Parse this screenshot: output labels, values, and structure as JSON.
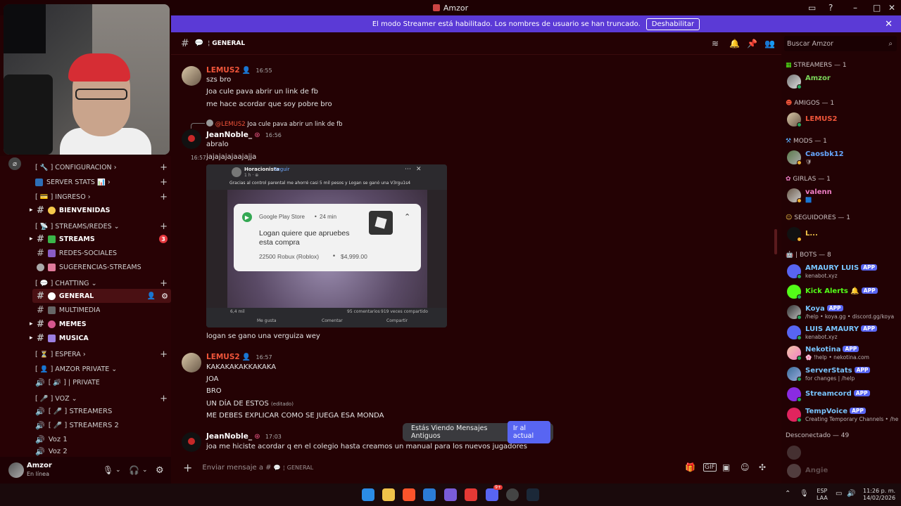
{
  "window": {
    "title": "Amzor"
  },
  "banner": {
    "text": "El modo Streamer está habilitado. Los nombres de usuario se han truncado.",
    "button": "Deshabilitar"
  },
  "channels": [
    {
      "label": "[ 🔧 ] CONFIGURACION",
      "kind": "category",
      "chevron": "›"
    },
    {
      "label": "SERVER STATS 📊",
      "kind": "category",
      "chevron": "›"
    },
    {
      "label": "[ 💳 ] INGRESO",
      "kind": "category",
      "chevron": "›"
    },
    {
      "label": "BIENVENIDAS",
      "kind": "channel",
      "bold": true
    },
    {
      "label": "[ 📡 ] STREAMS/REDES",
      "kind": "category",
      "chevron": "⌄"
    },
    {
      "label": "STREAMS",
      "kind": "channel",
      "bold": true,
      "badge": "3"
    },
    {
      "label": "REDES-SOCIALES",
      "kind": "channel"
    },
    {
      "label": "SUGERENCIAS-STREAMS",
      "kind": "channel"
    },
    {
      "label": "[ 💬 ] CHATTING",
      "kind": "category",
      "chevron": "⌄"
    },
    {
      "label": "GENERAL",
      "kind": "channel",
      "bold": true,
      "active": true
    },
    {
      "label": "MULTIMEDIA",
      "kind": "channel"
    },
    {
      "label": "MEMES",
      "kind": "channel",
      "bold": true
    },
    {
      "label": "MUSICA",
      "kind": "channel",
      "bold": true
    },
    {
      "label": "[ ⏳ ] ESPERA",
      "kind": "category",
      "chevron": "›"
    },
    {
      "label": "[ 👤 ] AMZOR PRIVATE",
      "kind": "category",
      "chevron": "⌄"
    },
    {
      "label": "[ 🔊 ] | PRIVATE",
      "kind": "voice"
    },
    {
      "label": "[ 🎤 ] VOZ",
      "kind": "category",
      "chevron": "⌄"
    },
    {
      "label": "[ 🎤 ] STREAMERS",
      "kind": "voice"
    },
    {
      "label": "[ 🎤 ] STREAMERS 2",
      "kind": "voice"
    },
    {
      "label": "Voz 1",
      "kind": "voice"
    },
    {
      "label": "Voz 2",
      "kind": "voice"
    }
  ],
  "user_panel": {
    "name": "Amzor",
    "status": "En línea"
  },
  "header": {
    "channel": "GENERAL",
    "search_placeholder": "Buscar Amzor"
  },
  "messages": {
    "m1": {
      "author": "LEMUS2",
      "time": "16:55",
      "lines": [
        "szs bro",
        "Joa cule pava abrir un link de fb",
        "me hace acordar que soy pobre bro"
      ]
    },
    "reply": {
      "mention": "@LEMUS2",
      "text": "Joa cule pava abrir un link de fb"
    },
    "m2": {
      "author": "JeanNoble_",
      "time": "16:56",
      "line1": "abralo",
      "time2": "16:57",
      "line2": "jajajajajaajajja"
    },
    "embed": {
      "page": "Horacionista",
      "follow": "Seguir",
      "meta": "1 h · ⊕",
      "caption": "Gracias al control parental me ahorré casi 5 mil pesos y Logan se ganó una V3rgu1s4",
      "store": "Google Play Store",
      "age": "24 min",
      "request": "Logan quiere que apruebes esta compra",
      "item": "22500 Robux (Roblox)",
      "price": "$4,999.00",
      "reactions": "6,4 mil",
      "comments": "95 comentarios",
      "shares": "919 veces compartido",
      "like": "Me gusta",
      "comment": "Comentar",
      "share": "Compartir"
    },
    "m2_after": "logan se gano una verguiza wey",
    "m3": {
      "author": "LEMUS2",
      "time": "16:57",
      "lines": [
        "KAKAKAKAKKAKAKA",
        "JOA",
        "BRO",
        "UN DÍA DE ESTOS",
        "ME DEBES EXPLICAR COMO SE JUEGA ESA MONDA"
      ],
      "edited": "(editado)"
    },
    "m4": {
      "author": "JeanNoble_",
      "time": "17:03",
      "line": "joa me hiciste acordar q en el colegio hasta creamos un manual para los nuevos jugadores"
    }
  },
  "old_messages": {
    "text": "Estás Viendo Mensajes Antiguos",
    "button": "Ir al actual"
  },
  "composer": {
    "placeholder": "Enviar mensaje a #",
    "channel": "GENERAL"
  },
  "members": {
    "groups": [
      {
        "label": "STREAMERS — 1",
        "members": [
          {
            "name": "Amzor",
            "color": "#7cd65b",
            "sub": ""
          }
        ]
      },
      {
        "label": "AMIGOS — 1",
        "members": [
          {
            "name": "LEMUS2",
            "color": "#f0553a",
            "sub": ""
          }
        ]
      },
      {
        "label": "MODS — 1",
        "members": [
          {
            "name": "Caosbk12",
            "color": "#67a7ff",
            "sub": "🛡"
          }
        ]
      },
      {
        "label": "GIRLAS — 1",
        "members": [
          {
            "name": "valenn",
            "color": "#f07ec6",
            "sub": "🟦"
          }
        ]
      },
      {
        "label": "SEGUIDORES — 1",
        "members": [
          {
            "name": "L...",
            "color": "#f5c84b",
            "sub": ""
          }
        ]
      },
      {
        "label": "| BOTS — 8",
        "members": [
          {
            "name": "AMAURY LUIS",
            "color": "#78c5ff",
            "sub": "kenabot.xyz",
            "app": "APP"
          },
          {
            "name": "Kick Alerts 🔔",
            "color": "#53fc18",
            "sub": "",
            "app": "APP"
          },
          {
            "name": "Koya",
            "color": "#78c5ff",
            "sub": "/help • koya.gg • discord.gg/koya",
            "app": "APP"
          },
          {
            "name": "LUIS AMAURY",
            "color": "#78c5ff",
            "sub": "kenabot.xyz",
            "app": "APP"
          },
          {
            "name": "Nekotina",
            "color": "#78c5ff",
            "sub": "🌸 !help • nekotina.com",
            "app": "APP"
          },
          {
            "name": "ServerStats",
            "color": "#78c5ff",
            "sub": "for changes | /help",
            "app": "APP"
          },
          {
            "name": "Streamcord",
            "color": "#78c5ff",
            "sub": "",
            "app": "APP"
          },
          {
            "name": "TempVoice",
            "color": "#78c5ff",
            "sub": "Creating Temporary Channels • /hel",
            "app": "APP"
          }
        ]
      }
    ],
    "offline_label": "Desconectado — 49",
    "offline_name": "Angie"
  },
  "taskbar": {
    "lang1": "ESP",
    "lang2": "LAA",
    "time": "11:26 p. m.",
    "date": "14/02/2026",
    "discord_badge": "9+"
  }
}
